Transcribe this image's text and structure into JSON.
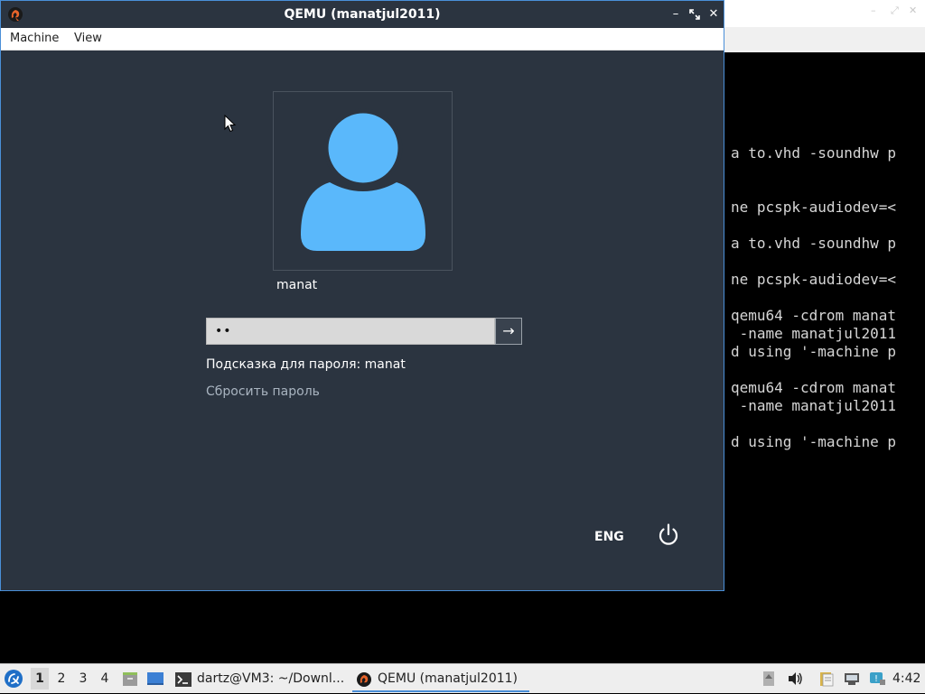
{
  "qemu": {
    "title": "QEMU (manatjul2011)",
    "menu": [
      "Machine",
      "View"
    ]
  },
  "login": {
    "username": "manat",
    "password_mask": "••",
    "submit_symbol": "→",
    "hint": "Подсказка для пароля: manat",
    "reset": "Сбросить пароль",
    "language": "ENG"
  },
  "terminal": {
    "lines": [
      "a to.vhd -soundhw p",
      "ne pcspk-audiodev=<",
      "a to.vhd -soundhw p",
      "ne pcspk-audiodev=<",
      "qemu64 -cdrom manat",
      " -name manatjul2011",
      "d using '-machine p",
      "qemu64 -cdrom manat",
      " -name manatjul2011",
      "d using '-machine p"
    ]
  },
  "taskbar": {
    "workspaces": [
      "1",
      "2",
      "3",
      "4"
    ],
    "tasks": [
      {
        "label": "dartz@VM3: ~/Downl..."
      },
      {
        "label": "QEMU (manatjul2011)"
      }
    ],
    "clock": "4:42"
  },
  "colors": {
    "accent": "#4a8fd8",
    "avatar": "#5ab8fb",
    "screen_bg": "#2b3440"
  }
}
